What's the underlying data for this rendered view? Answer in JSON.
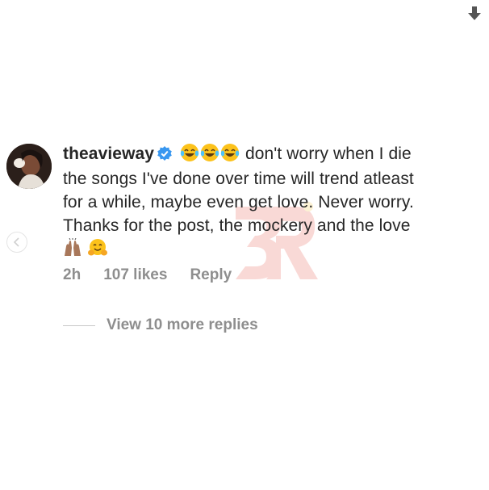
{
  "comment": {
    "username": "theavieway",
    "line1_text": "don't worry when I die",
    "line2_text": "the songs I've done over time will trend atleast",
    "line3_text": "for a while, maybe even get love. Never worry.",
    "line4_text": "Thanks for the post, the mockery and the love",
    "verified_icon": "verified-badge-icon",
    "lead_emojis": [
      "face-with-tears-of-joy",
      "face-with-tears-of-joy",
      "face-with-tears-of-joy"
    ],
    "trail_emojis": [
      "raising-hands",
      "hugging-face"
    ]
  },
  "meta": {
    "time": "2h",
    "likes": "107 likes",
    "reply_label": "Reply"
  },
  "replies": {
    "view_more_label": "View 10 more replies"
  },
  "colors": {
    "text": "#262626",
    "muted": "#8e8e8e",
    "verified": "#3897f0",
    "watermark": "#e8574a"
  }
}
